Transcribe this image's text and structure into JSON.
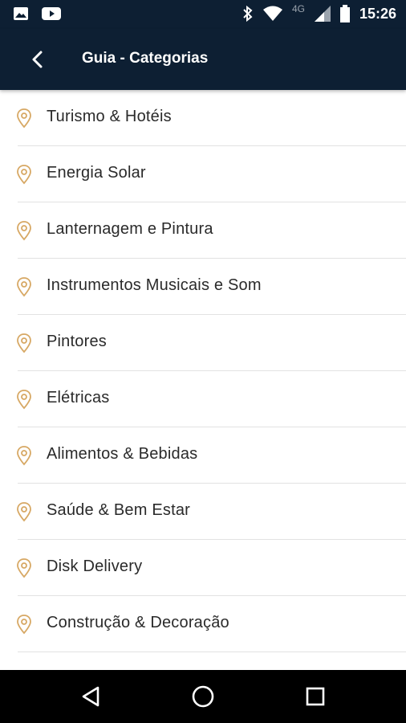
{
  "status_bar": {
    "time": "15:26",
    "network": "4G",
    "icons": [
      "image-icon",
      "youtube-icon",
      "bluetooth-icon",
      "wifi-icon",
      "signal-icon",
      "battery-icon"
    ]
  },
  "app_bar": {
    "title": "Guia - Categorias",
    "back_icon": "chevron-left-icon"
  },
  "categories": [
    {
      "label": "Turismo & Hotéis"
    },
    {
      "label": "Energia Solar"
    },
    {
      "label": "Lanternagem e Pintura"
    },
    {
      "label": "Instrumentos Musicais e Som"
    },
    {
      "label": "Pintores"
    },
    {
      "label": "Elétricas"
    },
    {
      "label": "Alimentos & Bebidas"
    },
    {
      "label": "Saúde & Bem Estar"
    },
    {
      "label": "Disk Delivery"
    },
    {
      "label": "Construção & Decoração"
    }
  ],
  "nav_bar": {
    "icons": [
      "back-triangle-icon",
      "home-circle-icon",
      "recents-square-icon"
    ]
  },
  "colors": {
    "app_bar": "#0d1f33",
    "pin_accent": "#d7a864",
    "nav_bar": "#000000",
    "divider": "#e2e2e2"
  }
}
